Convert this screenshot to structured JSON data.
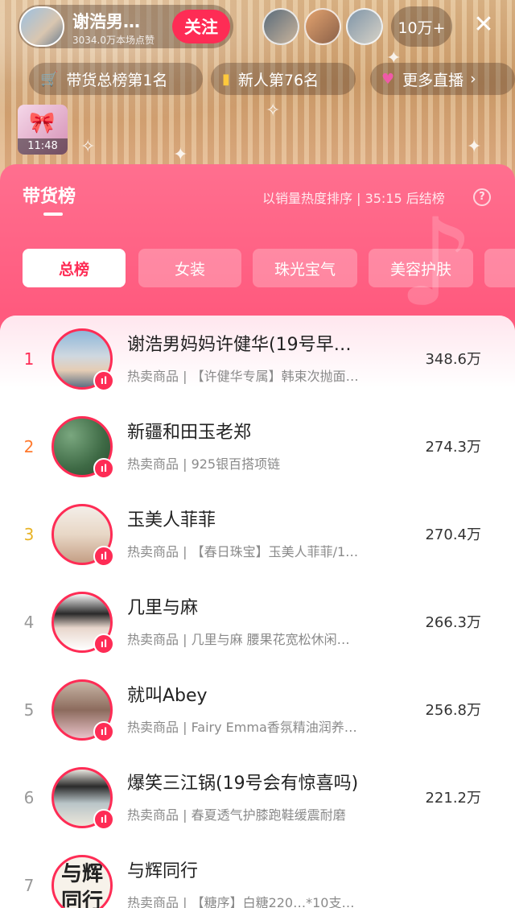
{
  "live_header": {
    "host_name": "谢浩男…",
    "host_likes": "3034.0万本场点赞",
    "follow_label": "关注",
    "viewer_count": "10万+",
    "close_icon": "close-icon",
    "pills": [
      {
        "icon": "cart-icon",
        "label": "带货总榜第1名"
      },
      {
        "icon": "bar-chart-icon",
        "label": "新人第76名"
      },
      {
        "icon": "heart-box-icon",
        "label": "更多直播"
      }
    ],
    "mini_video_time": "11:48"
  },
  "panel": {
    "title": "带货榜",
    "note": "以销量热度排序 | 35:15 后结榜",
    "tabs": [
      "总榜",
      "女装",
      "珠光宝气",
      "美容护肤",
      ""
    ],
    "active_tab": "总榜"
  },
  "ranking": [
    {
      "rank": "1",
      "name": "谢浩男妈妈许健华(19号早…",
      "sub": "热卖商品 | 【许健华专属】韩束次抛面…",
      "score": "348.6万"
    },
    {
      "rank": "2",
      "name": "新疆和田玉老郑",
      "sub": "热卖商品 | 925银百搭项链",
      "score": "274.3万"
    },
    {
      "rank": "3",
      "name": "玉美人菲菲",
      "sub": "热卖商品 | 【春日珠宝】玉美人菲菲/1…",
      "score": "270.4万"
    },
    {
      "rank": "4",
      "name": "几里与麻",
      "sub": "热卖商品 | 几里与麻 腰果花宽松休闲…",
      "score": "266.3万"
    },
    {
      "rank": "5",
      "name": "就叫Abey",
      "sub": "热卖商品 | Fairy Emma香氛精油润养…",
      "score": "256.8万"
    },
    {
      "rank": "6",
      "name": "爆笑三江锅(19号会有惊喜吗)",
      "sub": "热卖商品 | 春夏透气护膝跑鞋缓震耐磨",
      "score": "221.2万"
    },
    {
      "rank": "7",
      "name": "与辉同行",
      "sub": "热卖商品 | 【糖序】白糖220…*10支…",
      "score": ""
    }
  ],
  "avatar7_text": "与辉同行"
}
